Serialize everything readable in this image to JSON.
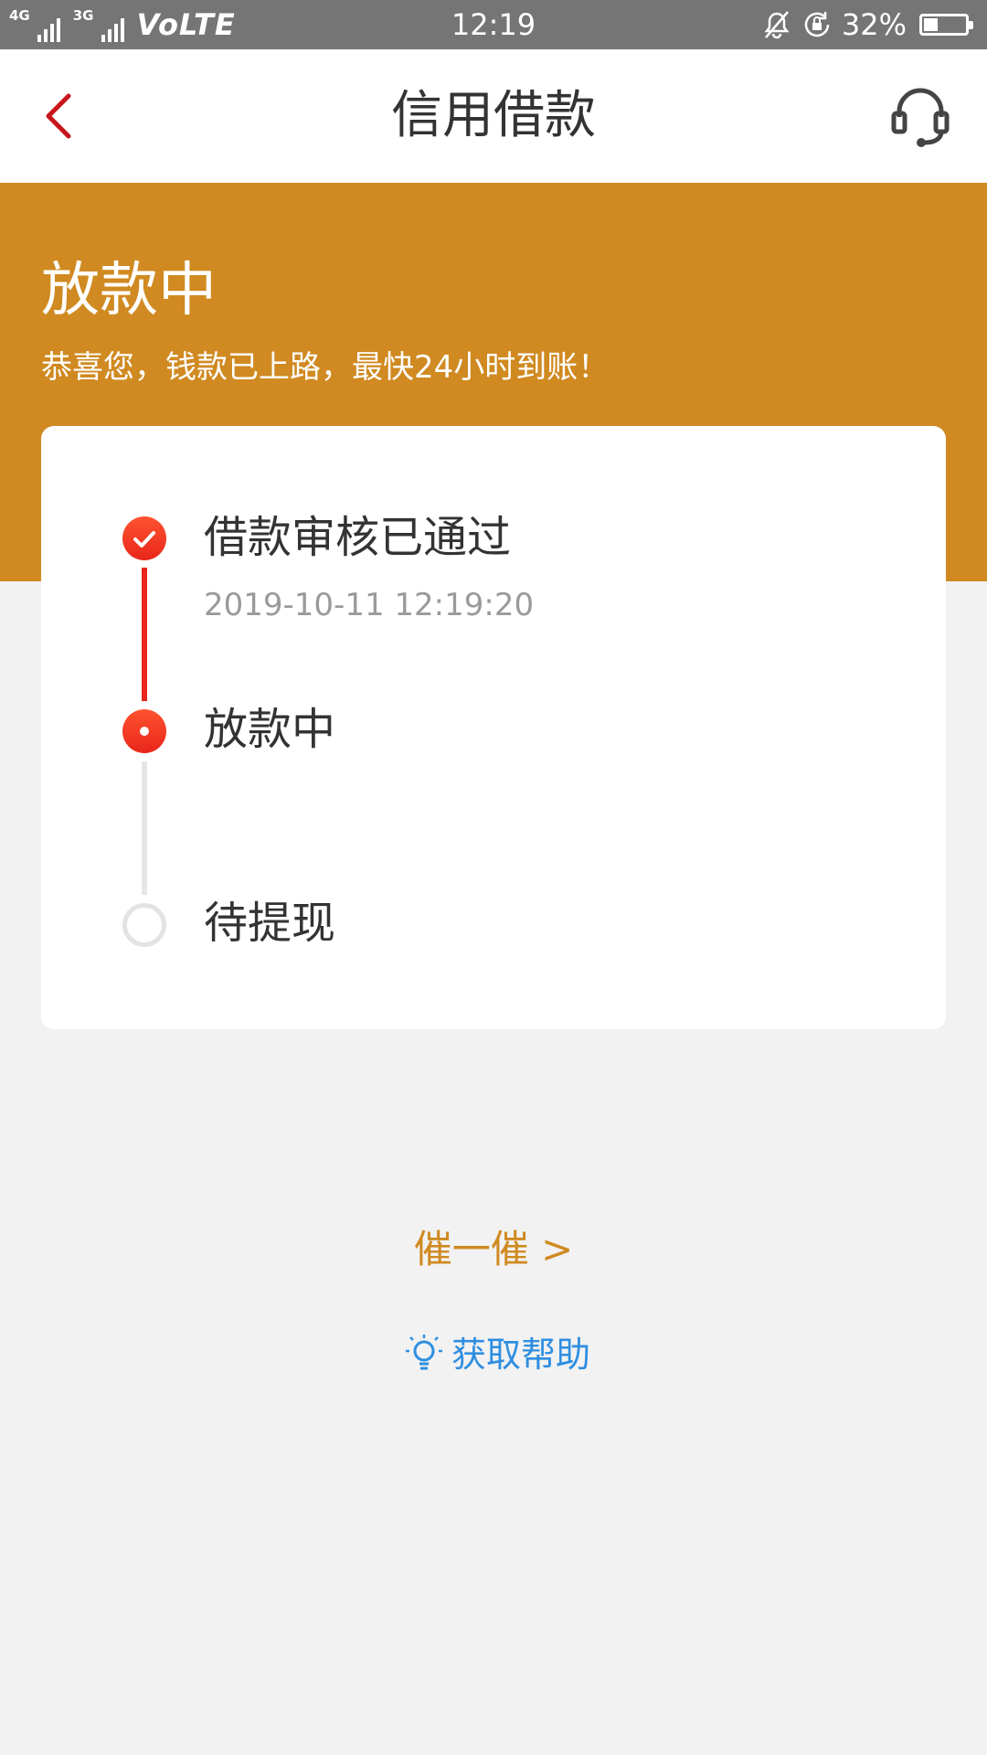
{
  "status_bar": {
    "network_4g": "4G",
    "network_3g": "3G",
    "volte": "VoLTE",
    "time": "12:19",
    "battery_percent": "32%",
    "battery_level": 0.32,
    "icons": [
      "bell-muted-icon",
      "rotation-lock-icon"
    ]
  },
  "nav": {
    "title": "信用借款",
    "back_icon": "chevron-left-icon",
    "service_icon": "headset-icon",
    "accent_color": "#c8161d"
  },
  "hero": {
    "title": "放款中",
    "subtitle": "恭喜您，钱款已上路，最快24小时到账！",
    "background_color": "#d08a21"
  },
  "progress": {
    "steps": [
      {
        "label": "借款审核已通过",
        "time": "2019-10-11 12:19:20",
        "status": "done"
      },
      {
        "label": "放款中",
        "status": "active"
      },
      {
        "label": "待提现",
        "status": "pending"
      }
    ]
  },
  "actions": {
    "urge_label": "催一催 >",
    "help_label": "获取帮助",
    "help_icon": "lightbulb-icon"
  }
}
